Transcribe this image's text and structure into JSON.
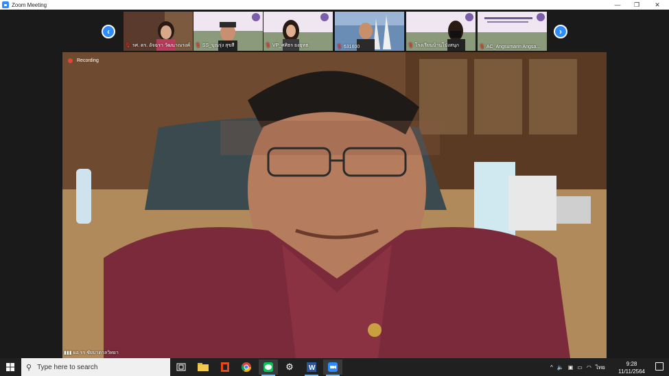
{
  "window": {
    "title": "Zoom Meeting"
  },
  "participants": [
    {
      "name": "รศ. ดร. อัจฉรา วัฒนาณรงค์"
    },
    {
      "name": "SS_บุณรุ่ง สุขสี"
    },
    {
      "name": "VP_ศศิธร ยงยุทธ"
    },
    {
      "name": "631600"
    },
    {
      "name": "โรงเรียนบ้านโป่งสนุก"
    },
    {
      "name": "AC_Angsumarin Angsa..."
    }
  ],
  "main_video": {
    "recording_label": "Recording",
    "speaker_name": "ผอ รร ชัยบาดาลวิทยา"
  },
  "taskbar": {
    "search_placeholder": "Type here to search",
    "language": "ไทย",
    "time": "9:28",
    "date": "11/11/2564"
  },
  "colors": {
    "zoom_blue": "#2d8cff",
    "recording_red": "#e0453a"
  }
}
